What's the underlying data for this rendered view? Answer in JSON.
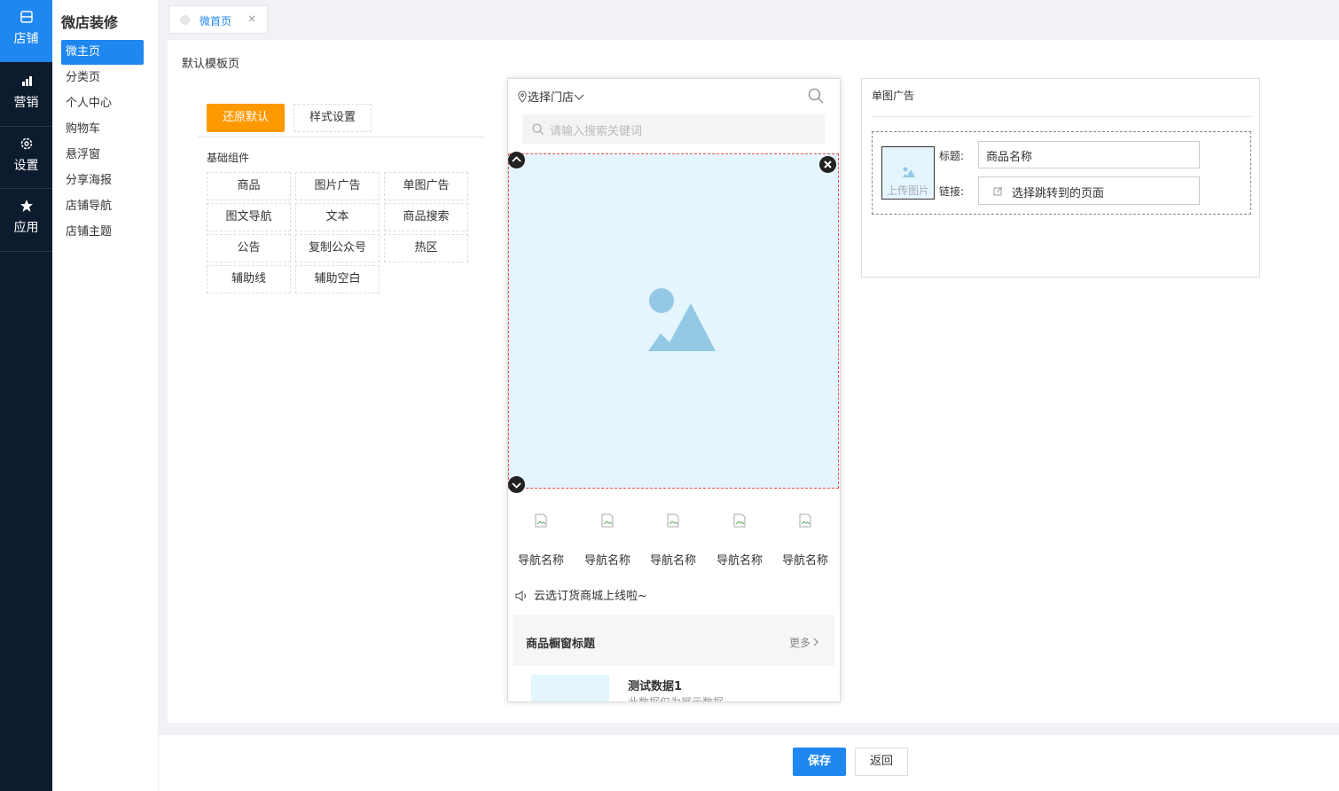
{
  "rail": {
    "items": [
      {
        "label": "店铺",
        "icon": "store-icon",
        "active": true
      },
      {
        "label": "营销",
        "icon": "bar-chart-icon",
        "active": false
      },
      {
        "label": "设置",
        "icon": "gear-icon",
        "active": false
      },
      {
        "label": "应用",
        "icon": "star-icon",
        "active": false
      }
    ]
  },
  "subnav": {
    "title": "微店装修",
    "items": [
      {
        "label": "微主页",
        "active": true
      },
      {
        "label": "分类页"
      },
      {
        "label": "个人中心"
      },
      {
        "label": "购物车"
      },
      {
        "label": "悬浮窗"
      },
      {
        "label": "分享海报"
      },
      {
        "label": "店铺导航"
      },
      {
        "label": "店铺主题"
      }
    ]
  },
  "tab": {
    "label": "微首页",
    "close": "×"
  },
  "page_heading": "默认模板页",
  "toolbar": {
    "restore_label": "还原默认",
    "style_label": "样式设置"
  },
  "components": {
    "group_title": "基础组件",
    "items": [
      "商品",
      "图片广告",
      "单图广告",
      "图文导航",
      "文本",
      "商品搜索",
      "公告",
      "复制公众号",
      "热区",
      "辅助线",
      "辅助空白"
    ]
  },
  "phone": {
    "store_select": "选择门店",
    "search_placeholder": "请输入搜索关键词",
    "nav_items": [
      "导航名称",
      "导航名称",
      "导航名称",
      "导航名称",
      "导航名称"
    ],
    "notice": "云选订货商城上线啦~",
    "showcase_title": "商品橱窗标题",
    "showcase_more": "更多",
    "product_name": "测试数据1",
    "product_desc": "此数据仅为展示数据"
  },
  "panel": {
    "title": "单图广告",
    "upload_label": "上传图片",
    "title_label": "标题:",
    "title_value": "商品名称",
    "link_label": "链接:",
    "link_value": "选择跳转到的页面"
  },
  "footer": {
    "save_label": "保存",
    "back_label": "返回"
  },
  "colors": {
    "accent": "#1f87f0",
    "orange": "#ff9900",
    "rail_bg": "#0d1b2e",
    "placeholder_bg": "#e4f5fd"
  }
}
